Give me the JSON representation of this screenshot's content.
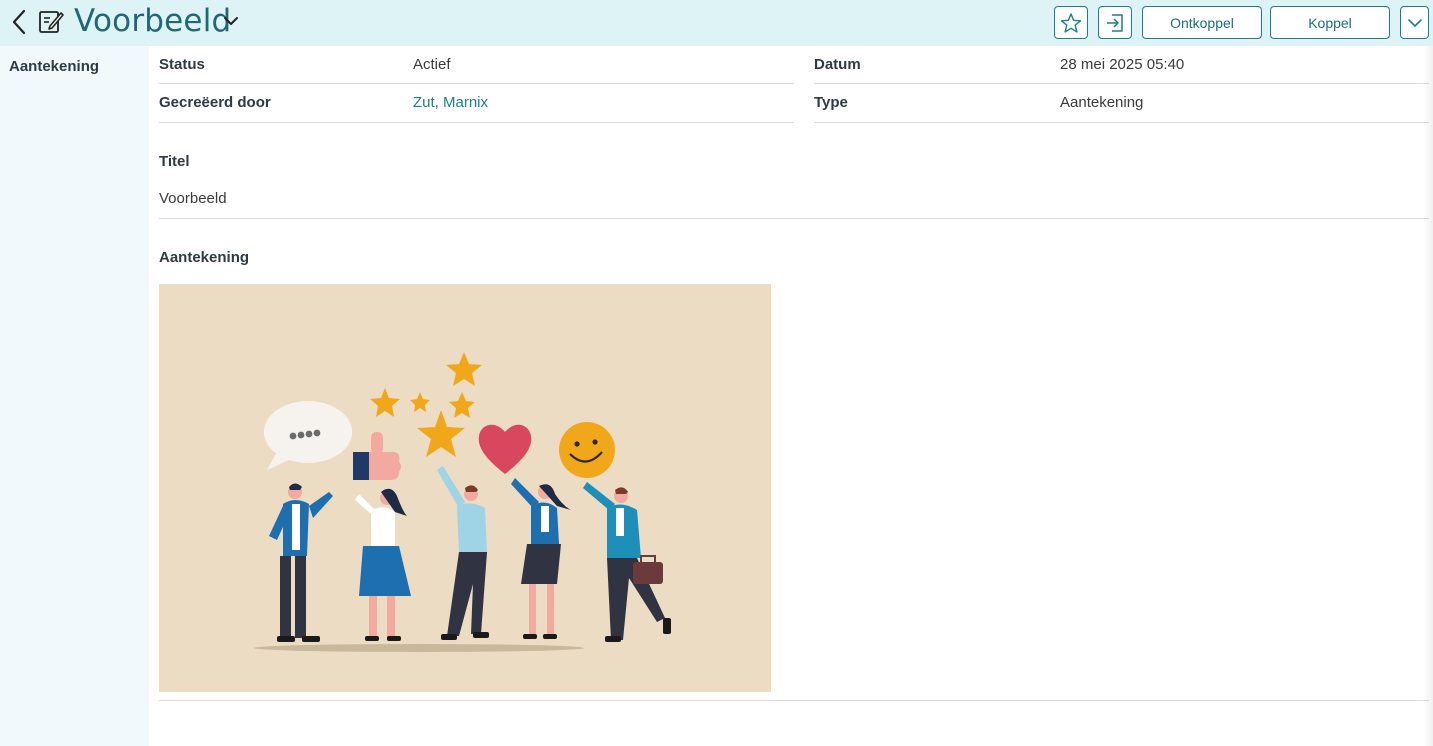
{
  "header": {
    "title": "Voorbeeld",
    "unlink_label": "Ontkoppel",
    "link_label": "Koppel",
    "icons": [
      "back-icon",
      "note-edit-icon",
      "chevron-down-icon",
      "star-icon",
      "open-in-icon",
      "chevron-down-icon"
    ]
  },
  "sidebar": {
    "items": [
      {
        "label": "Aantekening"
      }
    ]
  },
  "details": {
    "status_label": "Status",
    "status_value": "Actief",
    "created_by_label": "Gecreëerd door",
    "created_by_value": "Zut, Marnix",
    "date_label": "Datum",
    "date_value": "28 mei 2025 05:40",
    "type_label": "Type",
    "type_value": "Aantekening",
    "title_label": "Titel",
    "title_value": "Voorbeeld",
    "note_label": "Aantekening"
  },
  "colors": {
    "accent": "#1b7f8c",
    "header_bg": "#ddf3f6",
    "sidebar_bg": "#f1f9fc",
    "title_color": "#1f6874",
    "illustration_bg": "#ecdcc4"
  }
}
